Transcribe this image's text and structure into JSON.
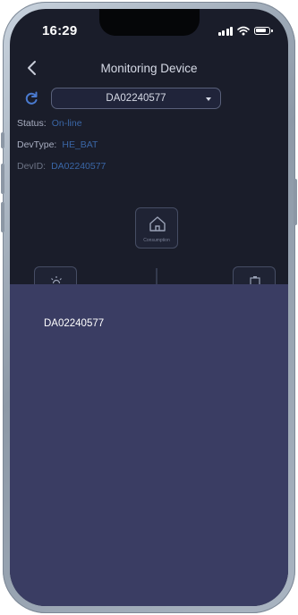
{
  "status_bar": {
    "time": "16:29",
    "icons": [
      "signal-icon",
      "wifi-icon",
      "battery-icon"
    ]
  },
  "header": {
    "title": "Monitoring Device",
    "back_icon": "chevron-left-icon"
  },
  "device_selector": {
    "value": "DA02240577",
    "refresh_icon": "refresh-icon",
    "caret_icon": "caret-down-icon"
  },
  "info": {
    "status_label": "Status:",
    "status_value": "On-line",
    "devtype_label": "DevType:",
    "devtype_value": "HE_BAT",
    "devid_label": "DevID:",
    "devid_value": "DA02240577"
  },
  "diagram": {
    "consumption_label": "Consumption",
    "consumption_icon": "house-icon",
    "left_icon": "sun-icon",
    "right_icon": "battery-icon"
  },
  "dropdown_sheet": {
    "options": [
      "DA02240577"
    ]
  },
  "colors": {
    "background": "#1a1d2a",
    "sheet": "#3a3d63",
    "accent_value": "#3a66a6",
    "text": "#d6dae6"
  }
}
